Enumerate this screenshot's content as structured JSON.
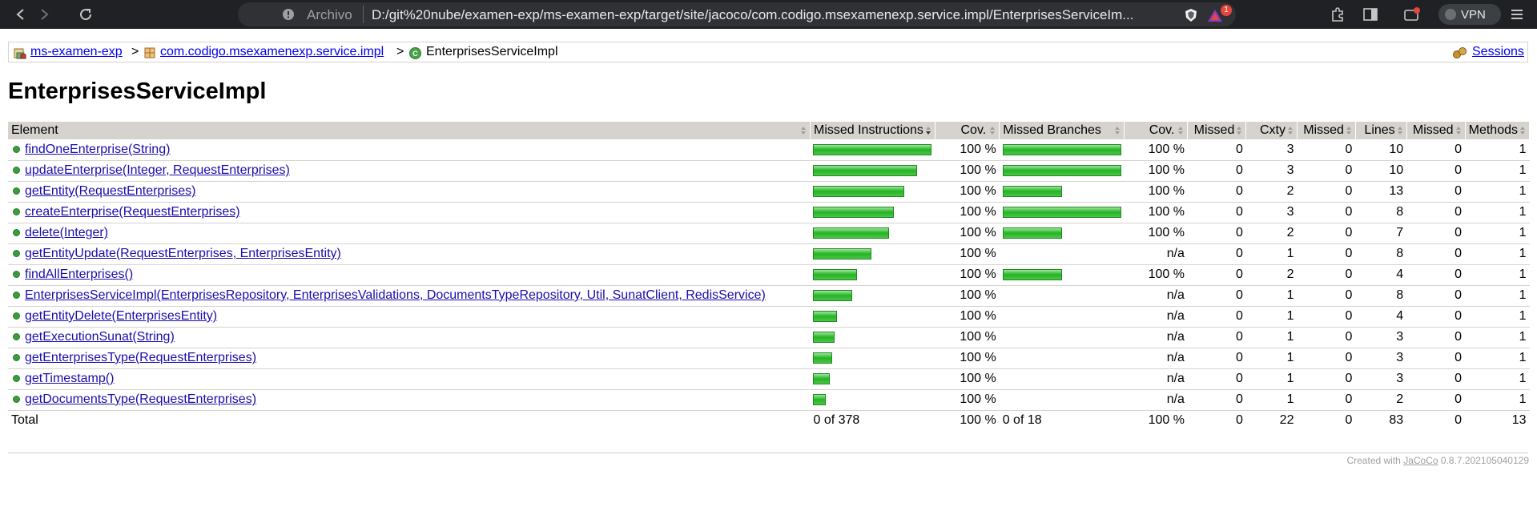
{
  "browser": {
    "url_scheme": "Archivo",
    "url": "D:/git%20nube/examen-exp/ms-examen-exp/target/site/jacoco/com.codigo.msexamenexp.service.impl/EnterprisesServiceIm...",
    "badge_count": "1",
    "vpn_label": "VPN"
  },
  "breadcrumb": {
    "project": "ms-examen-exp",
    "package": "com.codigo.msexamenexp.service.impl",
    "class": "EnterprisesServiceImpl",
    "separator": ">",
    "sessions": "Sessions"
  },
  "page_title": "EnterprisesServiceImpl",
  "table": {
    "headers": {
      "element": "Element",
      "missed_instructions": "Missed Instructions",
      "cov1": "Cov.",
      "missed_branches": "Missed Branches",
      "cov2": "Cov.",
      "missed_cxty": "Missed",
      "cxty": "Cxty",
      "missed_lines": "Missed",
      "lines": "Lines",
      "missed_methods": "Missed",
      "methods": "Methods"
    },
    "rows": [
      {
        "name": "findOneEnterprise(String)",
        "instr_bar": 1.0,
        "instr_cov": "100 %",
        "branch_bar": 1.0,
        "branch_cov": "100 %",
        "mc": "0",
        "cx": "3",
        "ml": "0",
        "ln": "10",
        "mm": "0",
        "mt": "1"
      },
      {
        "name": "updateEnterprise(Integer, RequestEnterprises)",
        "instr_bar": 0.88,
        "instr_cov": "100 %",
        "branch_bar": 1.0,
        "branch_cov": "100 %",
        "mc": "0",
        "cx": "3",
        "ml": "0",
        "ln": "10",
        "mm": "0",
        "mt": "1"
      },
      {
        "name": "getEntity(RequestEnterprises)",
        "instr_bar": 0.77,
        "instr_cov": "100 %",
        "branch_bar": 0.5,
        "branch_cov": "100 %",
        "mc": "0",
        "cx": "2",
        "ml": "0",
        "ln": "13",
        "mm": "0",
        "mt": "1"
      },
      {
        "name": "createEnterprise(RequestEnterprises)",
        "instr_bar": 0.68,
        "instr_cov": "100 %",
        "branch_bar": 1.0,
        "branch_cov": "100 %",
        "mc": "0",
        "cx": "3",
        "ml": "0",
        "ln": "8",
        "mm": "0",
        "mt": "1"
      },
      {
        "name": "delete(Integer)",
        "instr_bar": 0.64,
        "instr_cov": "100 %",
        "branch_bar": 0.5,
        "branch_cov": "100 %",
        "mc": "0",
        "cx": "2",
        "ml": "0",
        "ln": "7",
        "mm": "0",
        "mt": "1"
      },
      {
        "name": "getEntityUpdate(RequestEnterprises, EnterprisesEntity)",
        "instr_bar": 0.49,
        "instr_cov": "100 %",
        "branch_bar": 0,
        "branch_cov": "n/a",
        "mc": "0",
        "cx": "1",
        "ml": "0",
        "ln": "8",
        "mm": "0",
        "mt": "1"
      },
      {
        "name": "findAllEnterprises()",
        "instr_bar": 0.37,
        "instr_cov": "100 %",
        "branch_bar": 0.5,
        "branch_cov": "100 %",
        "mc": "0",
        "cx": "2",
        "ml": "0",
        "ln": "4",
        "mm": "0",
        "mt": "1"
      },
      {
        "name": "EnterprisesServiceImpl(EnterprisesRepository, EnterprisesValidations, DocumentsTypeRepository, Util, SunatClient, RedisService)",
        "instr_bar": 0.33,
        "instr_cov": "100 %",
        "branch_bar": 0,
        "branch_cov": "n/a",
        "mc": "0",
        "cx": "1",
        "ml": "0",
        "ln": "8",
        "mm": "0",
        "mt": "1"
      },
      {
        "name": "getEntityDelete(EnterprisesEntity)",
        "instr_bar": 0.2,
        "instr_cov": "100 %",
        "branch_bar": 0,
        "branch_cov": "n/a",
        "mc": "0",
        "cx": "1",
        "ml": "0",
        "ln": "4",
        "mm": "0",
        "mt": "1"
      },
      {
        "name": "getExecutionSunat(String)",
        "instr_bar": 0.18,
        "instr_cov": "100 %",
        "branch_bar": 0,
        "branch_cov": "n/a",
        "mc": "0",
        "cx": "1",
        "ml": "0",
        "ln": "3",
        "mm": "0",
        "mt": "1"
      },
      {
        "name": "getEnterprisesType(RequestEnterprises)",
        "instr_bar": 0.16,
        "instr_cov": "100 %",
        "branch_bar": 0,
        "branch_cov": "n/a",
        "mc": "0",
        "cx": "1",
        "ml": "0",
        "ln": "3",
        "mm": "0",
        "mt": "1"
      },
      {
        "name": "getTimestamp()",
        "instr_bar": 0.14,
        "instr_cov": "100 %",
        "branch_bar": 0,
        "branch_cov": "n/a",
        "mc": "0",
        "cx": "1",
        "ml": "0",
        "ln": "3",
        "mm": "0",
        "mt": "1"
      },
      {
        "name": "getDocumentsType(RequestEnterprises)",
        "instr_bar": 0.11,
        "instr_cov": "100 %",
        "branch_bar": 0,
        "branch_cov": "n/a",
        "mc": "0",
        "cx": "1",
        "ml": "0",
        "ln": "2",
        "mm": "0",
        "mt": "1"
      }
    ],
    "total": {
      "label": "Total",
      "instr": "0 of 378",
      "instr_cov": "100 %",
      "branch": "0 of 18",
      "branch_cov": "100 %",
      "mc": "0",
      "cx": "22",
      "ml": "0",
      "ln": "83",
      "mm": "0",
      "mt": "13"
    }
  },
  "footer": {
    "prefix": "Created with",
    "tool": "JaCoCo",
    "version": "0.8.7.202105040129"
  },
  "colors": {
    "header_bg": "#d6d3ce",
    "bar_green": "#22b522",
    "method_dot": "#3b9c3e"
  }
}
